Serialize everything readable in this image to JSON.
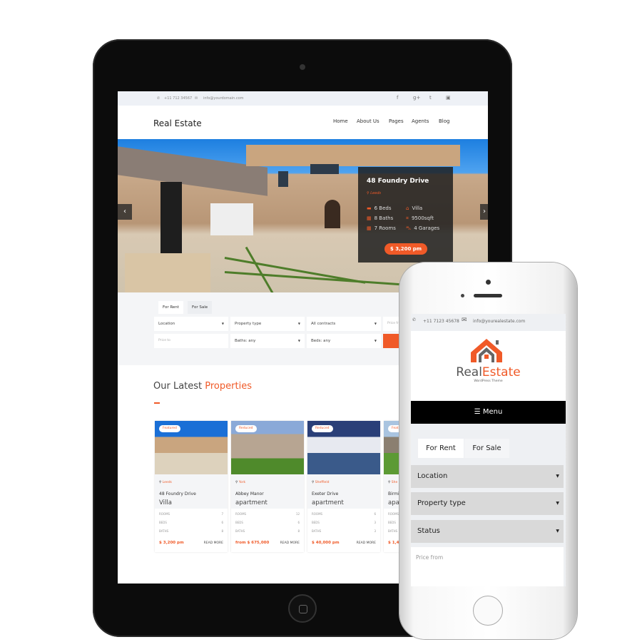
{
  "tablet": {
    "topbar": {
      "phone": "+11 712 34567",
      "email": "info@yourdomain.com",
      "social_icons": [
        "facebook-icon",
        "google-plus-icon",
        "twitter-icon",
        "youtube-icon"
      ]
    },
    "header": {
      "title": "Real Estate",
      "nav": [
        "Home",
        "About Us",
        "Pages",
        "Agents",
        "Blog"
      ]
    },
    "hero": {
      "title": "48 Foundry Drive",
      "location": "Leeds",
      "features": [
        "6 Beds",
        "Villa",
        "8 Baths",
        "9500sqft",
        "7 Rooms",
        "4 Garages"
      ],
      "price": "$ 3,200 pm"
    },
    "search": {
      "tabs": [
        "For Rent",
        "For Sale"
      ],
      "fields": [
        "Location",
        "Property type",
        "All contracts"
      ],
      "placeholders": [
        "Price fr",
        "Price to"
      ],
      "fields2": [
        "Baths: any",
        "Beds: any"
      ]
    },
    "section": {
      "title": "Our Latest",
      "title_accent": "Properties"
    },
    "labels": {
      "rooms": "ROOMS",
      "beds": "BEDS",
      "baths": "BATHS",
      "read_more": "READ MORE"
    },
    "cards": [
      {
        "badge": "Featured",
        "location": "Leeds",
        "name": "48 Foundry Drive",
        "type": "Villa",
        "rooms": "7",
        "beds": "6",
        "baths": "8",
        "price": "$ 3,200 pm"
      },
      {
        "badge": "Reduced",
        "location": "York",
        "name": "Abbey Manor",
        "type": "apartment",
        "rooms": "12",
        "beds": "6",
        "baths": "8",
        "price": "from $ 675,000"
      },
      {
        "badge": "Reduced",
        "location": "Sheffield",
        "name": "Exeter Drive",
        "type": "apartment",
        "rooms": "6",
        "beds": "3",
        "baths": "3",
        "price": "$ 40,000 pm"
      },
      {
        "badge": "Featured",
        "location": "She",
        "name": "Birmi",
        "type": "apar",
        "rooms": "",
        "beds": "",
        "baths": "",
        "price": "$ 1,40"
      }
    ]
  },
  "phone": {
    "topbar": {
      "phone": "+11 7123 45678",
      "email": "info@yourealestate.com"
    },
    "logo": {
      "part1": "Real",
      "part2": "Estate",
      "sub": "WordPress Theme"
    },
    "menu": "Menu",
    "tabs": [
      "For Rent",
      "For Sale"
    ],
    "selects": [
      "Location",
      "Property type",
      "Status"
    ],
    "price_placeholder": "Price from"
  },
  "colors": {
    "accent": "#f05a28",
    "dark": "#1e1e1e"
  }
}
